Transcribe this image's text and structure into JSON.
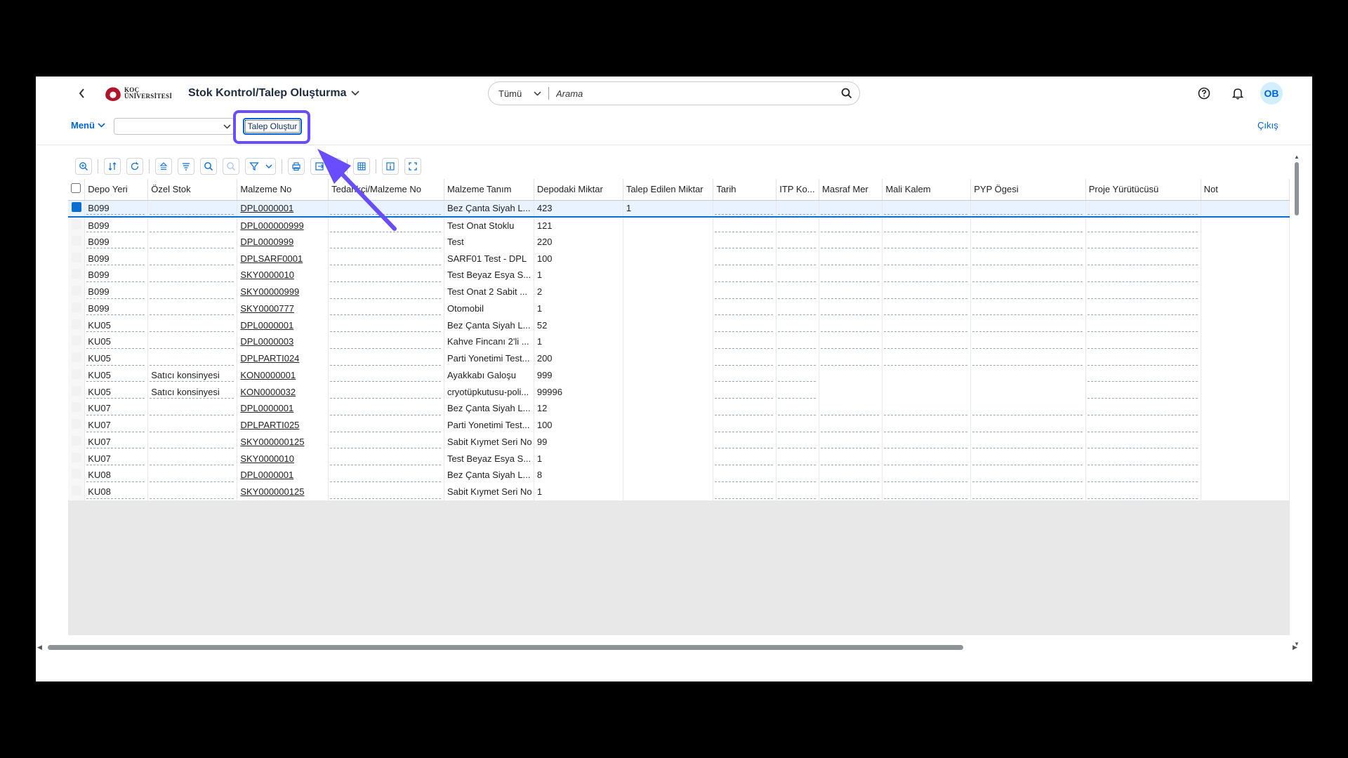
{
  "header": {
    "back_icon": "chevron-left-icon",
    "logo_line1": "KOÇ",
    "logo_line2": "ÜNİVERSİTESİ",
    "app_title": "Stok Kontrol/Talep Oluşturma",
    "search_scope": "Tümü",
    "search_placeholder": "Arama",
    "avatar_initials": "OB"
  },
  "subbar": {
    "menu_label": "Menü",
    "select_value": "",
    "create_request_label": "Talep Oluştur",
    "logout_label": "Çıkış"
  },
  "toolbar": {
    "buttons": [
      "zoom-details-icon",
      "sort-icon",
      "refresh-icon",
      "sort-ascending-icon",
      "sort-descending-icon",
      "find-icon",
      "find-next-icon",
      "filter-icon",
      "print-icon",
      "export-icon",
      "layout-icon",
      "info-icon",
      "fullscreen-icon"
    ]
  },
  "table": {
    "columns": [
      "Depo Yeri",
      "Özel Stok",
      "Malzeme No",
      "Tedarikçi/Malzeme No",
      "Malzeme Tanım",
      "Depodaki Miktar",
      "Talep Edilen Miktar",
      "Tarih",
      "ITP Ko...",
      "Masraf Mer",
      "Mali Kalem",
      "PYP Ögesi",
      "Proje Yürütücüsü",
      "Not"
    ],
    "rows": [
      {
        "depo": "B099",
        "ozel": "",
        "malzeme_no": "DPL0000001",
        "tedarikci": "",
        "tanim": "Bez Çanta Siyah L...",
        "miktar": "423",
        "talep": "1"
      },
      {
        "depo": "B099",
        "ozel": "",
        "malzeme_no": "DPL000000999",
        "tedarikci": "",
        "tanim": "Test Onat Stoklu",
        "miktar": "121",
        "talep": ""
      },
      {
        "depo": "B099",
        "ozel": "",
        "malzeme_no": "DPL0000999",
        "tedarikci": "",
        "tanim": "Test",
        "miktar": "220",
        "talep": ""
      },
      {
        "depo": "B099",
        "ozel": "",
        "malzeme_no": "DPLSARF0001",
        "tedarikci": "",
        "tanim": "SARF01 Test - DPL",
        "miktar": "100",
        "talep": ""
      },
      {
        "depo": "B099",
        "ozel": "",
        "malzeme_no": "SKY0000010",
        "tedarikci": "",
        "tanim": "Test Beyaz Esya S...",
        "miktar": "1",
        "talep": ""
      },
      {
        "depo": "B099",
        "ozel": "",
        "malzeme_no": "SKY00000999",
        "tedarikci": "",
        "tanim": "Test Onat 2 Sabit ...",
        "miktar": "2",
        "talep": ""
      },
      {
        "depo": "B099",
        "ozel": "",
        "malzeme_no": "SKY0000777",
        "tedarikci": "",
        "tanim": "Otomobil",
        "miktar": "1",
        "talep": ""
      },
      {
        "depo": "KU05",
        "ozel": "",
        "malzeme_no": "DPL0000001",
        "tedarikci": "",
        "tanim": "Bez Çanta Siyah L...",
        "miktar": "52",
        "talep": ""
      },
      {
        "depo": "KU05",
        "ozel": "",
        "malzeme_no": "DPL0000003",
        "tedarikci": "",
        "tanim": "Kahve Fincanı 2'li ...",
        "miktar": "1",
        "talep": ""
      },
      {
        "depo": "KU05",
        "ozel": "",
        "malzeme_no": "DPLPARTI024",
        "tedarikci": "",
        "tanim": "Parti Yonetimi Test...",
        "miktar": "200",
        "talep": ""
      },
      {
        "depo": "KU05",
        "ozel": "Satıcı konsinyesi",
        "malzeme_no": "KON0000001",
        "tedarikci": "",
        "tanim": "Ayakkabı Galoşu",
        "miktar": "999",
        "talep": ""
      },
      {
        "depo": "KU05",
        "ozel": "Satıcı konsinyesi",
        "malzeme_no": "KON0000032",
        "tedarikci": "",
        "tanim": "cryotüpkutusu-poli...",
        "miktar": "99996",
        "talep": ""
      },
      {
        "depo": "KU07",
        "ozel": "",
        "malzeme_no": "DPL0000001",
        "tedarikci": "",
        "tanim": "Bez Çanta Siyah L...",
        "miktar": "12",
        "talep": ""
      },
      {
        "depo": "KU07",
        "ozel": "",
        "malzeme_no": "DPLPARTI025",
        "tedarikci": "",
        "tanim": "Parti Yonetimi Test...",
        "miktar": "100",
        "talep": ""
      },
      {
        "depo": "KU07",
        "ozel": "",
        "malzeme_no": "SKY000000125",
        "tedarikci": "",
        "tanim": "Sabit Kıymet Seri No",
        "miktar": "99",
        "talep": ""
      },
      {
        "depo": "KU07",
        "ozel": "",
        "malzeme_no": "SKY0000010",
        "tedarikci": "",
        "tanim": "Test Beyaz Esya S...",
        "miktar": "1",
        "talep": ""
      },
      {
        "depo": "KU08",
        "ozel": "",
        "malzeme_no": "DPL0000001",
        "tedarikci": "",
        "tanim": "Bez Çanta Siyah L...",
        "miktar": "8",
        "talep": ""
      },
      {
        "depo": "KU08",
        "ozel": "",
        "malzeme_no": "SKY000000125",
        "tedarikci": "",
        "tanim": "Sabit Kıymet Seri No",
        "miktar": "1",
        "talep": ""
      }
    ]
  },
  "colors": {
    "accent": "#0064d9",
    "highlight_annotation": "#6a4dff",
    "selected_row": "#e8f3ff"
  }
}
